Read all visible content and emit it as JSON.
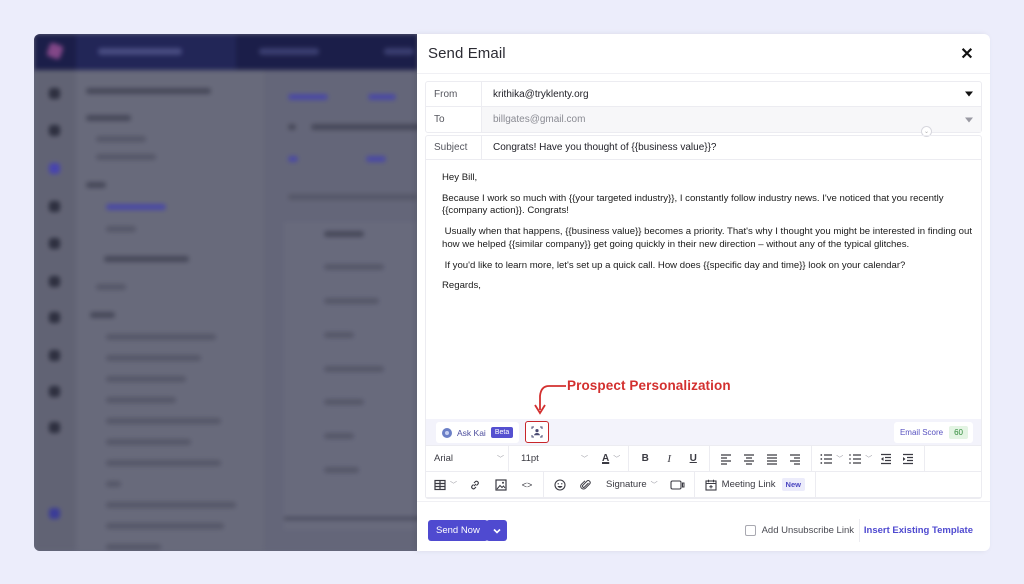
{
  "modal": {
    "title": "Send Email",
    "close_icon": "close-icon"
  },
  "fields": {
    "from_label": "From",
    "from_value": "krithika@tryklenty.org",
    "to_label": "To",
    "to_value": "billgates@gmail.com",
    "subject_label": "Subject",
    "subject_value": "Congrats! Have you thought of {{business value}}?"
  },
  "body": {
    "paragraphs": [
      "Hey Bill,",
      "Because I work so much with {{your targeted industry}}, I constantly follow industry news. I've noticed that you recently {{company action}}. Congrats!",
      " Usually when that happens, {{business value}} becomes a priority. That's why I thought you might be interested in finding out how we helped {{similar company}} get going quickly in their new direction – without any of the typical glitches.",
      " If you'd like to learn more, let's set up a quick call. How does {{specific day and time}} look on your calendar?",
      "Regards,"
    ]
  },
  "annotation": {
    "label": "Prospect Personalization",
    "color": "#d3302f"
  },
  "ai_bar": {
    "ask_kai_label": "Ask Kai",
    "beta_badge": "Beta",
    "personalization_icon": "user-focus-icon",
    "email_score_label": "Email Score",
    "email_score_value": "60"
  },
  "toolbar": {
    "font_family": "Arial",
    "font_size": "11pt",
    "signature_label": "Signature",
    "meeting_link_label": "Meeting Link",
    "new_badge": "New",
    "icons_row1": [
      "text-color-icon",
      "bold-icon",
      "italic-icon",
      "underline-icon",
      "align-left-icon",
      "align-center-icon",
      "align-justify-icon",
      "align-right-icon",
      "bullet-list-icon",
      "numbered-list-icon",
      "outdent-icon",
      "indent-icon"
    ],
    "icons_row2": [
      "table-icon",
      "link-icon",
      "image-icon",
      "code-icon",
      "emoji-icon",
      "attachment-icon",
      "video-icon",
      "calendar-icon"
    ]
  },
  "footer": {
    "send_now_label": "Send Now",
    "unsubscribe_label": "Add Unsubscribe Link",
    "unsubscribe_checked": false,
    "insert_template_label": "Insert Existing Template"
  },
  "colors": {
    "accent": "#4f4ad0",
    "page_background": "#ecedfb",
    "background_app_topbar": "#1b1e4a",
    "score_green": "#2f8a39"
  }
}
